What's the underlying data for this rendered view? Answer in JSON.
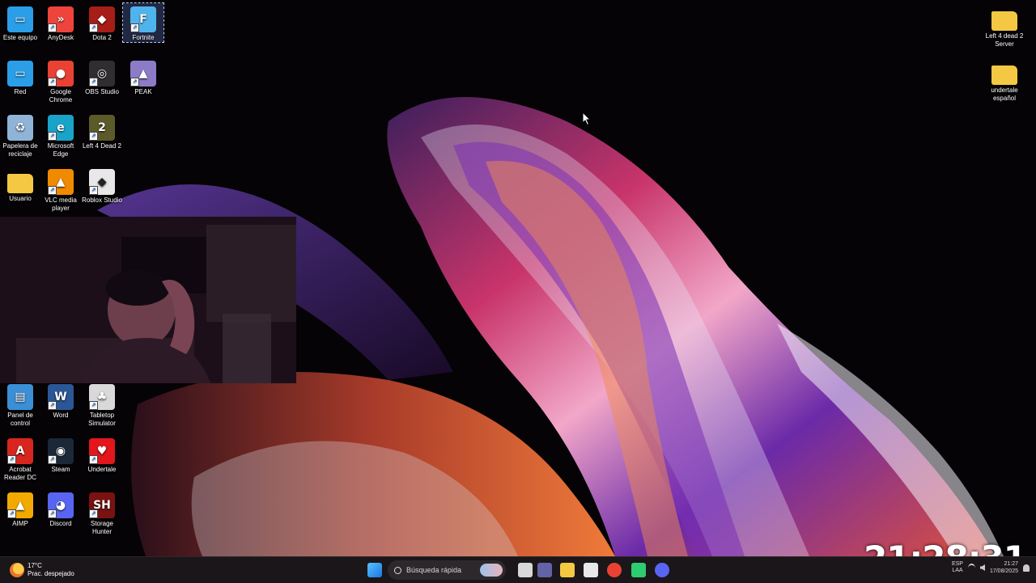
{
  "desktop": {
    "icons_left": [
      {
        "label": "Este equipo",
        "icon": "monitor-icon",
        "color": "#2b9ee8"
      },
      {
        "label": "AnyDesk",
        "icon": "anydesk-icon",
        "color": "#ef443b"
      },
      {
        "label": "Dota 2",
        "icon": "dota2-icon",
        "color": "#a61e17"
      },
      {
        "label": "Fortnite",
        "icon": "fortnite-icon",
        "color": "#4fb4ec"
      },
      {
        "label": "Red",
        "icon": "network-icon",
        "color": "#2b9ee8"
      },
      {
        "label": "Google Chrome",
        "icon": "chrome-icon",
        "color": "#e94235"
      },
      {
        "label": "OBS Studio",
        "icon": "obs-icon",
        "color": "#302e31"
      },
      {
        "label": "PEAK",
        "icon": "peak-icon",
        "color": "#8d7bc8"
      },
      {
        "label": "Papelera de reciclaje",
        "icon": "recycle-bin-icon",
        "color": "#8fb4d8"
      },
      {
        "label": "Microsoft Edge",
        "icon": "edge-icon",
        "color": "#1aa3c8"
      },
      {
        "label": "Left 4 Dead 2",
        "icon": "left4dead2-icon",
        "color": "#5d5a2a"
      },
      {
        "label": "Usuario",
        "icon": "folder-icon",
        "color": "#f4c842"
      },
      {
        "label": "VLC media player",
        "icon": "vlc-icon",
        "color": "#f08a00"
      },
      {
        "label": "Roblox Studio",
        "icon": "roblox-icon",
        "color": "#e8e8e8"
      },
      {
        "label": "Panel de control",
        "icon": "control-panel-icon",
        "color": "#3a8fd6"
      },
      {
        "label": "Word",
        "icon": "word-icon",
        "color": "#2b5797"
      },
      {
        "label": "Tabletop Simulator",
        "icon": "tabletop-icon",
        "color": "#d9d9d9"
      },
      {
        "label": "Acrobat Reader DC",
        "icon": "acrobat-icon",
        "color": "#d8261f"
      },
      {
        "label": "Steam",
        "icon": "steam-icon",
        "color": "#1b2838"
      },
      {
        "label": "Undertale",
        "icon": "heart-icon",
        "color": "#e3161b"
      },
      {
        "label": "AIMP",
        "icon": "aimp-icon",
        "color": "#f2a900"
      },
      {
        "label": "Discord",
        "icon": "discord-icon",
        "color": "#5865f2"
      },
      {
        "label": "Storage Hunter",
        "icon": "storage-hunter-icon",
        "color": "#7a1212"
      }
    ],
    "icons_right": [
      {
        "label": "Left 4 dead 2 Server",
        "icon": "folder-icon",
        "color": "#f4c842"
      },
      {
        "label": "undertale español",
        "icon": "folder-icon",
        "color": "#f4c842"
      }
    ]
  },
  "overlay": {
    "clock": "21:28:31"
  },
  "taskbar": {
    "weather_temp": "17°C",
    "weather_desc": "Prac. despejado",
    "search_placeholder": "Búsqueda rápida",
    "pinned": [
      {
        "name": "start-icon",
        "color": "#3aa0f0"
      },
      {
        "name": "task-view-icon",
        "color": "#d8d8d8"
      },
      {
        "name": "teams-icon",
        "color": "#6264a7"
      },
      {
        "name": "file-explorer-icon",
        "color": "#f4c842"
      },
      {
        "name": "store-icon",
        "color": "#e8e8e8"
      },
      {
        "name": "chrome-icon",
        "color": "#e94235"
      },
      {
        "name": "app-green-icon",
        "color": "#2ecc71"
      },
      {
        "name": "discord-icon",
        "color": "#5865f2"
      }
    ],
    "lang_top": "ESP",
    "lang_bottom": "LAA",
    "time": "21:27",
    "date": "17/08/2025"
  }
}
